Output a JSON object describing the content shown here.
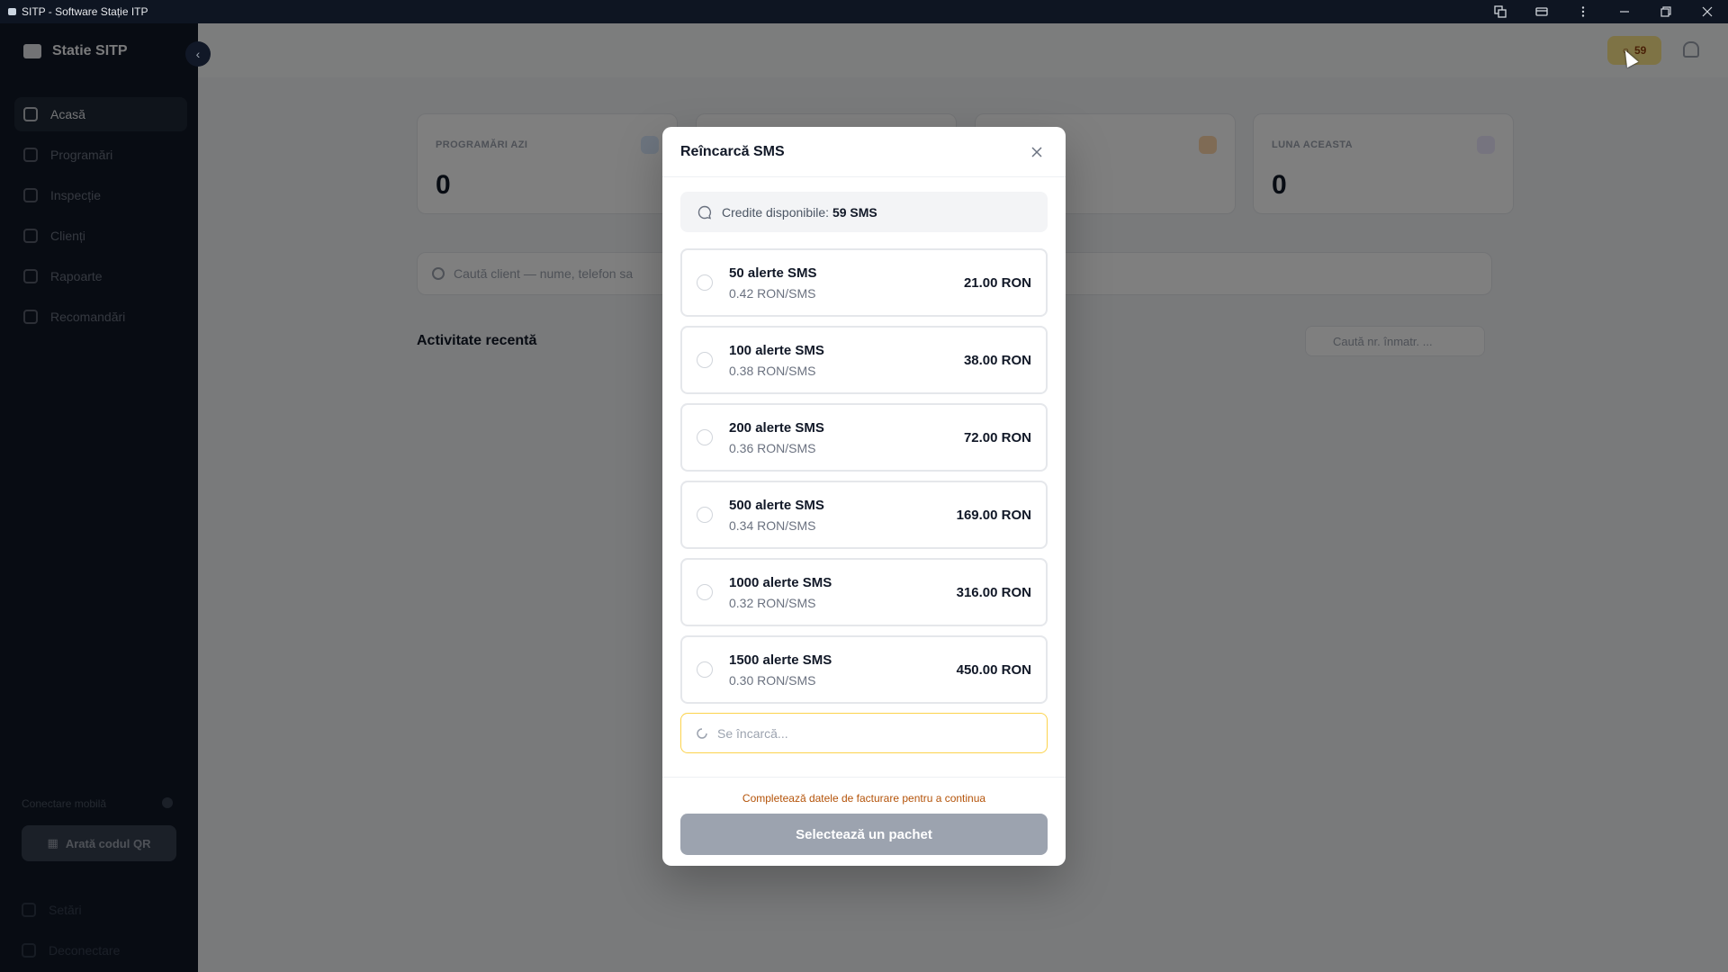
{
  "window": {
    "title": "SITP - Software Stație ITP"
  },
  "sidebar": {
    "brand": "Statie SITP",
    "items": [
      {
        "label": "Acasă",
        "icon": "home-icon",
        "active": true
      },
      {
        "label": "Programări",
        "icon": "calendar-icon"
      },
      {
        "label": "Inspecție",
        "icon": "inspection-icon"
      },
      {
        "label": "Clienți",
        "icon": "users-icon"
      },
      {
        "label": "Rapoarte",
        "icon": "chart-icon"
      },
      {
        "label": "Recomandări",
        "icon": "gift-icon"
      }
    ],
    "mobile_label": "Conectare mobilă",
    "qr_button": "Arată codul QR",
    "settings": "Setări",
    "logout": "Deconectare"
  },
  "main": {
    "sms_badge": "59",
    "cards": [
      {
        "label": "PROGRAMĂRI AZI",
        "value": "0",
        "icon_color": "#3b82f6"
      },
      {
        "label": "LUNA ACEASTA",
        "value": "0",
        "icon_color": "#a855f7"
      }
    ],
    "search_placeholder": "Caută client — nume, telefon sa",
    "recent_title": "Activitate recentă",
    "recent_search_placeholder": "Caută nr. înmatr. ..."
  },
  "modal": {
    "title": "Reîncarcă SMS",
    "credits_label": "Credite disponibile:",
    "credits_value": "59 SMS",
    "packages": [
      {
        "name": "50 alerte SMS",
        "unit": "0.42 RON/SMS",
        "price": "21.00 RON"
      },
      {
        "name": "100 alerte SMS",
        "unit": "0.38 RON/SMS",
        "price": "38.00 RON"
      },
      {
        "name": "200 alerte SMS",
        "unit": "0.36 RON/SMS",
        "price": "72.00 RON"
      },
      {
        "name": "500 alerte SMS",
        "unit": "0.34 RON/SMS",
        "price": "169.00 RON"
      },
      {
        "name": "1000 alerte SMS",
        "unit": "0.32 RON/SMS",
        "price": "316.00 RON"
      },
      {
        "name": "1500 alerte SMS",
        "unit": "0.30 RON/SMS",
        "price": "450.00 RON"
      }
    ],
    "loading_text": "Se încarcă...",
    "hint": "Completează datele de facturare pentru a continua",
    "submit": "Selectează un pachet"
  },
  "colors": {
    "accent_warning": "#fcd34d",
    "hint_text": "#b45309",
    "disabled_button": "#9ca3af"
  }
}
